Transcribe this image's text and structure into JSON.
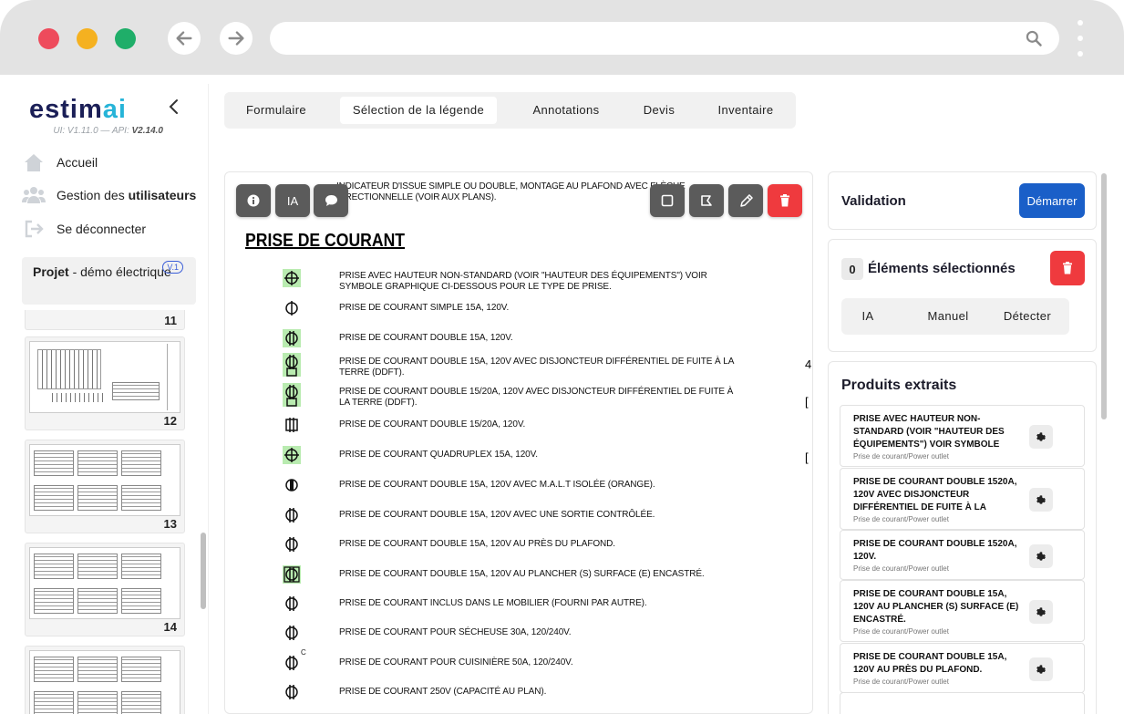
{
  "browser": {
    "icons": [
      "back-arrow-icon",
      "forward-arrow-icon",
      "search-icon",
      "kebab-menu-icon"
    ]
  },
  "sidebar": {
    "logo_text": "estim",
    "logo_accent": "ai",
    "version_ui": "UI: V1.11.0 — API: ",
    "version_api": "V2.14.0",
    "menu": [
      {
        "label": "Accueil",
        "icon": "home-icon"
      },
      {
        "label_prefix": "Gestion des ",
        "label_bold": "utilisateurs",
        "icon": "users-icon"
      },
      {
        "label": "Se déconnecter",
        "icon": "logout-icon"
      }
    ],
    "project": {
      "label_bold": "Projet",
      "label": " - démo électrique",
      "badge": "V.1"
    },
    "thumbnails": [
      {
        "page": "11"
      },
      {
        "page": "12"
      },
      {
        "page": "13"
      },
      {
        "page": "14"
      },
      {
        "page": ""
      }
    ]
  },
  "tabs": [
    {
      "label": "Formulaire",
      "active": false
    },
    {
      "label": "Sélection de la légende",
      "active": true
    },
    {
      "label": "Annotations",
      "active": false
    },
    {
      "label": "Devis",
      "active": false
    },
    {
      "label": "Inventaire",
      "active": false
    }
  ],
  "viewer": {
    "toolbar_left": [
      {
        "label": "",
        "icon": "info-icon"
      },
      {
        "label": "IA",
        "icon": ""
      },
      {
        "label": "",
        "icon": "comment-icon"
      }
    ],
    "toolbar_right": [
      {
        "icon": "square-select-icon"
      },
      {
        "icon": "polygon-select-icon"
      },
      {
        "icon": "pen-icon"
      },
      {
        "icon": "trash-icon"
      }
    ],
    "top_text_1": "INDICATEUR D'ISSUE SIMPLE OU DOUBLE, MONTAGE AU PLAFOND AVEC FLÈCHE",
    "top_text_2": "DIRECTIONNELLE (VOIR AUX PLANS).",
    "section_title": "PRISE DE COURANT",
    "legend": [
      {
        "text": "PRISE AVEC HAUTEUR NON-STANDARD (VOIR \"HAUTEUR DES ÉQUIPEMENTS\") VOIR SYMBOLE GRAPHIQUE CI-DESSOUS POUR LE TYPE DE PRISE.",
        "symbol": "outlet-cross-symbol"
      },
      {
        "text": "PRISE DE COURANT SIMPLE 15A, 120V.",
        "symbol": "outlet-simple-symbol"
      },
      {
        "text": "PRISE DE COURANT DOUBLE 15A, 120V.",
        "symbol": "outlet-double-symbol"
      },
      {
        "text": "PRISE DE COURANT DOUBLE 15A, 120V AVEC DISJONCTEUR DIFFÉRENTIEL DE FUITE À LA TERRE (DDFT).",
        "symbol": "outlet-gfci-symbol"
      },
      {
        "text": "PRISE DE COURANT DOUBLE 15/20A, 120V AVEC DISJONCTEUR  DIFFÉRENTIEL DE FUITE À LA TERRE (DDFT).",
        "symbol": "outlet-gfci-20a-symbol"
      },
      {
        "text": "PRISE DE COURANT DOUBLE 15/20A, 120V.",
        "symbol": "outlet-20a-symbol"
      },
      {
        "text": "PRISE DE COURANT QUADRUPLEX 15A, 120V.",
        "symbol": "outlet-quadruplex-symbol"
      },
      {
        "text": "PRISE DE COURANT DOUBLE 15A, 120V AVEC M.A.L.T ISOLÉE (ORANGE).",
        "symbol": "outlet-isolated-ground-symbol"
      },
      {
        "text": "PRISE DE COURANT DOUBLE 15A, 120V AVEC UNE SORTIE CONTRÔLÉE.",
        "symbol": "outlet-controlled-symbol"
      },
      {
        "text": "PRISE DE COURANT DOUBLE 15A, 120V AU PRÈS DU PLAFOND.",
        "symbol": "outlet-ceiling-symbol"
      },
      {
        "text": "PRISE DE COURANT DOUBLE 15A, 120V AU PLANCHER (S) SURFACE (E) ENCASTRÉ.",
        "symbol": "outlet-floor-symbol"
      },
      {
        "text": "PRISE DE COURANT INCLUS DANS LE MOBILIER (FOURNI PAR AUTRE).",
        "symbol": "outlet-furniture-symbol"
      },
      {
        "text": "PRISE DE COURANT POUR SÉCHEUSE 30A, 120/240V.",
        "symbol": "outlet-dryer-symbol"
      },
      {
        "text": "PRISE DE COURANT POUR CUISINIÈRE 50A, 120/240V.",
        "symbol": "outlet-range-symbol",
        "superscript": "C"
      },
      {
        "text": "PRISE DE COURANT 250V (CAPACITÉ AU PLAN).",
        "symbol": "outlet-250v-symbol"
      }
    ]
  },
  "validation": {
    "title": "Validation",
    "start_label": "Démarrer"
  },
  "selection": {
    "count": "0",
    "title": "Éléments sélectionnés",
    "modes": [
      "IA",
      "Manuel",
      "Détecter"
    ]
  },
  "products": {
    "title": "Produits extraits",
    "items": [
      {
        "name": "PRISE AVEC HAUTEUR NON-STANDARD (VOIR \"HAUTEUR DES ÉQUIPEMENTS\") VOIR SYMBOLE",
        "category": "Prise de courant/Power outlet"
      },
      {
        "name": "PRISE DE COURANT DOUBLE 1520A, 120V AVEC DISJONCTEUR DIFFÉRENTIEL DE FUITE À LA",
        "category": "Prise de courant/Power outlet"
      },
      {
        "name": "PRISE DE COURANT DOUBLE 1520A, 120V.",
        "category": "Prise de courant/Power outlet"
      },
      {
        "name": "PRISE DE COURANT DOUBLE 15A, 120V AU PLANCHER (S) SURFACE (E) ENCASTRÉ.",
        "category": "Prise de courant/Power outlet"
      },
      {
        "name": "PRISE DE COURANT DOUBLE 15A, 120V AU PRÈS DU PLAFOND.",
        "category": "Prise de courant/Power outlet"
      }
    ]
  }
}
